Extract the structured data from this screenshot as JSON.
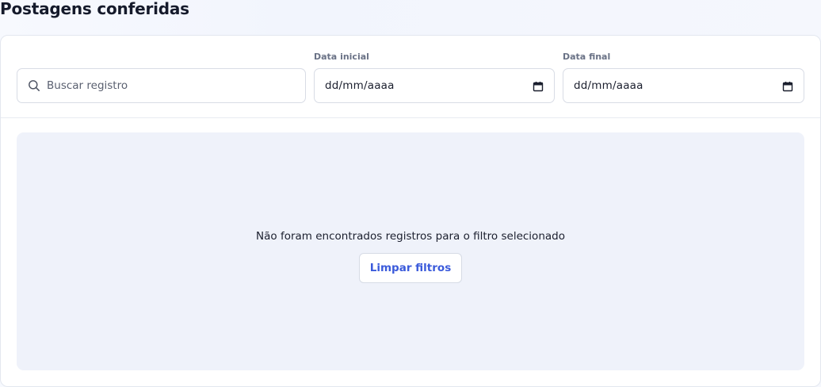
{
  "header": {
    "title": "Postagens conferidas"
  },
  "filters": {
    "search": {
      "placeholder": "Buscar registro",
      "value": "",
      "icon": "search-icon"
    },
    "start_date": {
      "label": "Data inicial",
      "value": "dd/mm/aaaa",
      "icon": "calendar-icon"
    },
    "end_date": {
      "label": "Data final",
      "value": "dd/mm/aaaa",
      "icon": "calendar-icon"
    }
  },
  "empty_state": {
    "message": "Não foram encontrados registros para o filtro selecionado",
    "clear_button_label": "Limpar filtros"
  },
  "colors": {
    "accent": "#3b5bdb",
    "empty_background": "#eff2fa"
  }
}
